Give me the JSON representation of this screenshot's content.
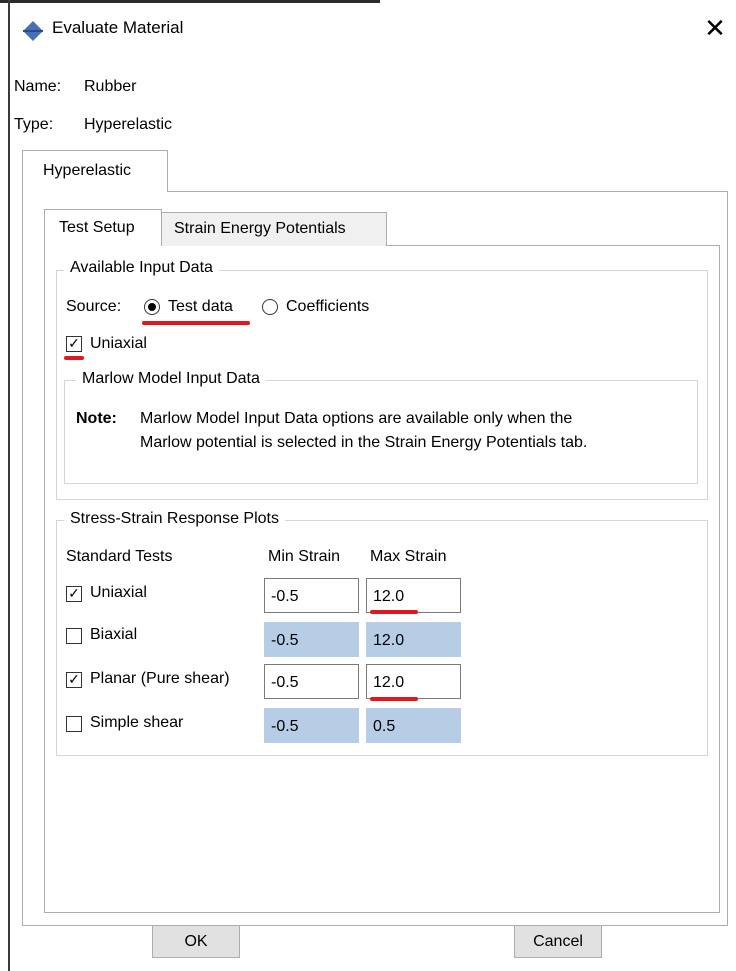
{
  "window": {
    "title": "Evaluate Material",
    "close_glyph": "✕",
    "icon": "material-diamond-icon"
  },
  "info": {
    "name_label": "Name:",
    "name_value": "Rubber",
    "type_label": "Type:",
    "type_value": "Hyperelastic"
  },
  "outer_tab": {
    "label": "Hyperelastic"
  },
  "inner_tabs": [
    {
      "label": "Test Setup",
      "active": true
    },
    {
      "label": "Strain Energy Potentials",
      "active": false
    }
  ],
  "available_input": {
    "title": "Available Input Data",
    "source_label": "Source:",
    "options": [
      {
        "label": "Test data",
        "selected": true
      },
      {
        "label": "Coefficients",
        "selected": false
      }
    ],
    "uniaxial_label": "Uniaxial",
    "uniaxial_checked": true
  },
  "marlow": {
    "title": "Marlow Model Input Data",
    "note_label": "Note:",
    "note_line1": "Marlow Model Input Data options are available only when the",
    "note_line2": "Marlow potential is selected in the Strain Energy Potentials tab."
  },
  "stress_strain": {
    "title": "Stress-Strain Response Plots",
    "col_tests": "Standard Tests",
    "col_min": "Min Strain",
    "col_max": "Max Strain",
    "rows": [
      {
        "label": "Uniaxial",
        "checked": true,
        "min": "-0.5",
        "max": "12.0",
        "enabled": true
      },
      {
        "label": "Biaxial",
        "checked": false,
        "min": "-0.5",
        "max": "12.0",
        "enabled": false
      },
      {
        "label": "Planar (Pure shear)",
        "checked": true,
        "min": "-0.5",
        "max": "12.0",
        "enabled": true
      },
      {
        "label": "Simple shear",
        "checked": false,
        "min": "-0.5",
        "max": "0.5",
        "enabled": false
      }
    ]
  },
  "buttons": {
    "ok": "OK",
    "cancel": "Cancel"
  },
  "colors": {
    "disabled_field": "#b6cde5",
    "annotation": "#e0191e",
    "icon": "#4a6fb5"
  }
}
